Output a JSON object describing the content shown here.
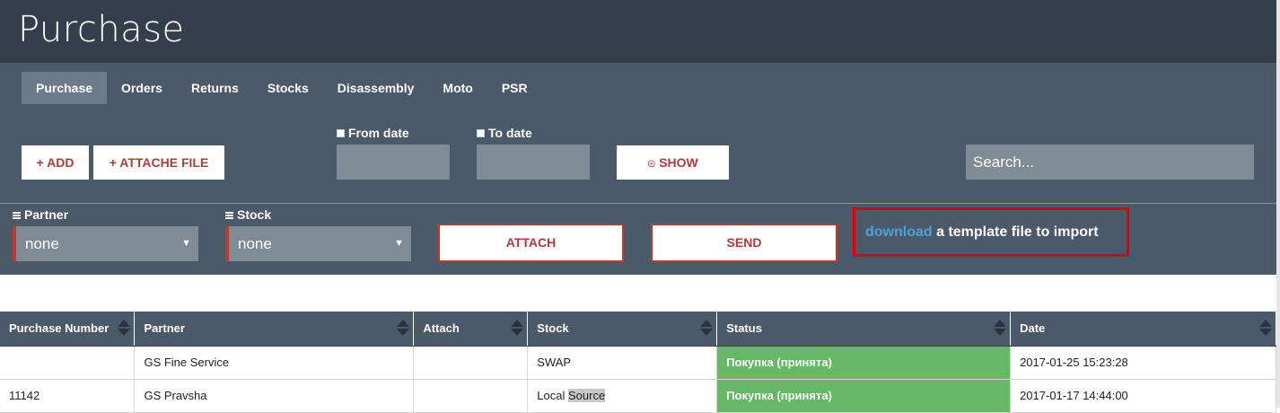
{
  "header": {
    "title": "Purchase"
  },
  "tabs": [
    {
      "label": "Purchase"
    },
    {
      "label": "Orders"
    },
    {
      "label": "Returns"
    },
    {
      "label": "Stocks"
    },
    {
      "label": "Disassembly"
    },
    {
      "label": "Moto"
    },
    {
      "label": "PSR"
    }
  ],
  "toolbar": {
    "add_label": "+ ADD",
    "attache_label": "+ ATTACHE FILE",
    "from_date_label": "From date",
    "to_date_label": "To date",
    "show_label": "SHOW",
    "search_placeholder": "Search..."
  },
  "import": {
    "partner_label": "Partner",
    "partner_value": "none",
    "stock_label": "Stock",
    "stock_value": "none",
    "attach_label": "ATTACH",
    "send_label": "SEND",
    "download_link": "download",
    "download_text": " a template file to import"
  },
  "table": {
    "columns": [
      "Purchase Number",
      "Partner",
      "Attach",
      "Stock",
      "Status",
      "Date"
    ],
    "rows": [
      {
        "number": "",
        "partner": "GS Fine Service",
        "attach": "",
        "stock": "SWAP",
        "stock_hl": "",
        "status": "Покупка (принята)",
        "date": "2017-01-25 15:23:28"
      },
      {
        "number": "11142",
        "partner": "GS Pravsha",
        "attach": "",
        "stock": "Local ",
        "stock_hl": "Source",
        "status": "Покупка (принята)",
        "date": "2017-01-17 14:44:00"
      }
    ]
  },
  "colors": {
    "header_bg": "#343f4b",
    "panel_bg": "#4a5a69",
    "accent_red": "#c0392b",
    "status_green": "#66b866",
    "link_blue": "#4aa3d9"
  }
}
